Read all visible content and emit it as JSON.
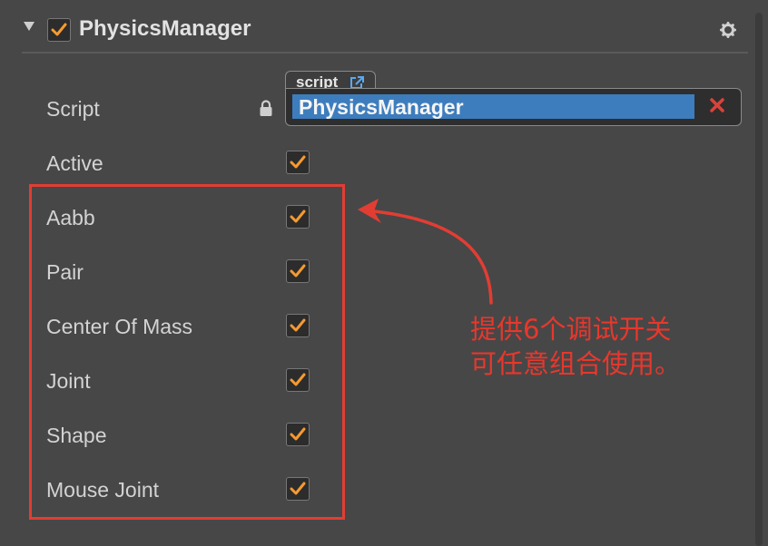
{
  "component": {
    "title": "PhysicsManager",
    "enabled": true
  },
  "script_field": {
    "label": "Script",
    "tag": "script",
    "value": "PhysicsManager"
  },
  "rows": [
    {
      "label": "Active",
      "checked": true
    },
    {
      "label": "Aabb",
      "checked": true
    },
    {
      "label": "Pair",
      "checked": true
    },
    {
      "label": "Center Of Mass",
      "checked": true
    },
    {
      "label": "Joint",
      "checked": true
    },
    {
      "label": "Shape",
      "checked": true
    },
    {
      "label": "Mouse Joint",
      "checked": true
    }
  ],
  "annotation": {
    "line1": "提供6个调试开关",
    "line2": "可任意组合使用。"
  },
  "colors": {
    "panel_bg": "#474747",
    "check_orange": "#f59a31",
    "field_selected": "#3e7dbd",
    "annotation_red": "#e23d33"
  },
  "icons": [
    "fold-arrow-icon",
    "checkbox-icon",
    "gear-icon",
    "lock-icon",
    "external-link-icon",
    "clear-x-icon",
    "annotation-arrow-icon"
  ]
}
